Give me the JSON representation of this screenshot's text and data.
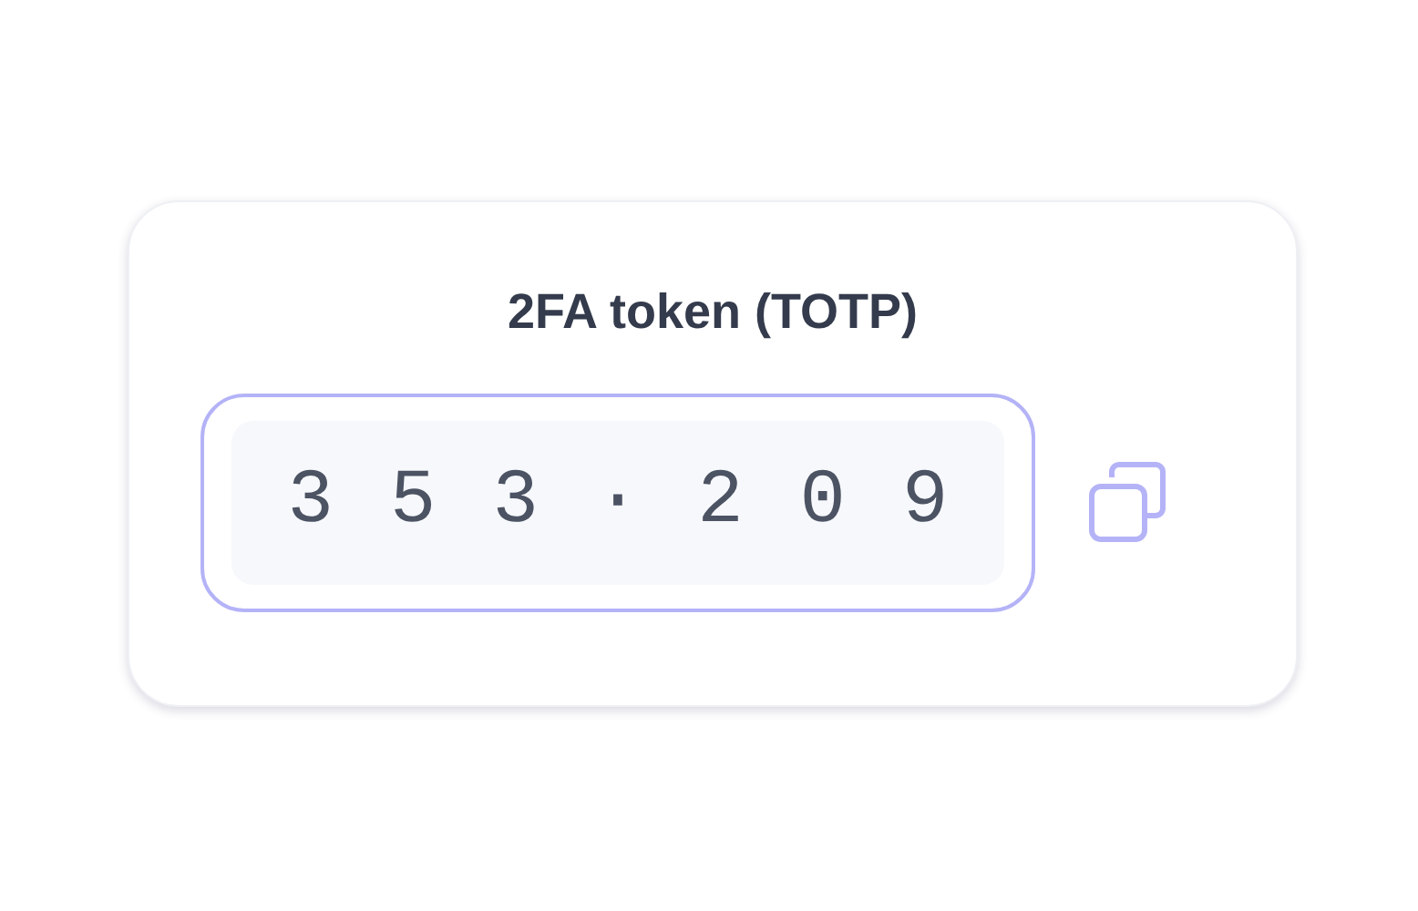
{
  "title": "2FA token (TOTP)",
  "token": "353·209"
}
